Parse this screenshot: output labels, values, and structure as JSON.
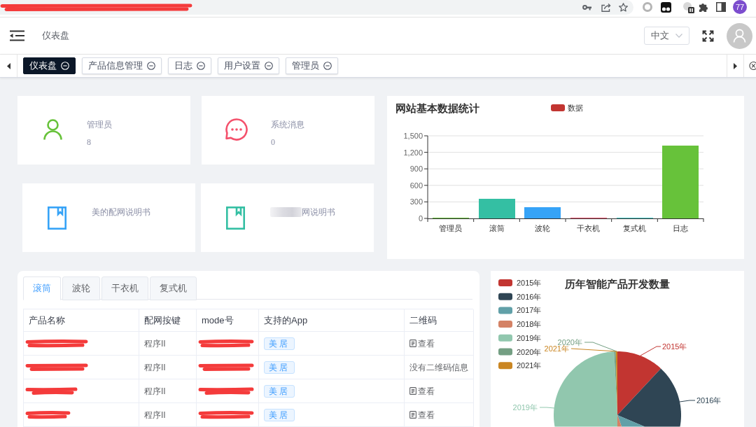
{
  "browser": {
    "address_redacted": true,
    "profile": "77"
  },
  "header": {
    "breadcrumb": "仪表盘",
    "language": "中文"
  },
  "tabs": [
    {
      "label": "仪表盘",
      "selected": true
    },
    {
      "label": "产品信息管理",
      "selected": false
    },
    {
      "label": "日志",
      "selected": false
    },
    {
      "label": "用户设置",
      "selected": false
    },
    {
      "label": "管理员",
      "selected": false
    }
  ],
  "stat_cards": [
    {
      "label": "管理员",
      "value": "8"
    },
    {
      "label": "系统消息",
      "value": "0"
    }
  ],
  "manual_cards": [
    {
      "title": "美的配网说明书",
      "blurred": false
    },
    {
      "title": "网说明书",
      "blurred": true
    }
  ],
  "bar_chart": {
    "chart_data": {
      "type": "bar",
      "title": "网站基本数据统计",
      "categories": [
        "管理员",
        "滚筒",
        "波轮",
        "干衣机",
        "复式机",
        "日志"
      ],
      "series": [
        {
          "name": "数据",
          "values": [
            8,
            350,
            200,
            10,
            5,
            1320
          ]
        }
      ],
      "ylim": [
        0,
        1500
      ],
      "yticks": [
        0,
        300,
        600,
        900,
        {
          "value": 1200,
          "label": "1,200"
        },
        {
          "value": 1500,
          "label": "1,500"
        }
      ],
      "grid": true
    },
    "legend_swatch": {
      "color": "#c23531"
    },
    "bars": [
      {
        "color": "#67c23a"
      },
      {
        "color": "#34bfa3"
      },
      {
        "color": "#36a3f7"
      },
      {
        "color": "#f4516c"
      },
      {
        "color": "#40c9c6"
      },
      {
        "color": "#67c23a"
      }
    ]
  },
  "product_table": {
    "tabs": [
      {
        "label": "滚筒",
        "selected": true
      },
      {
        "label": "波轮",
        "selected": false
      },
      {
        "label": "干衣机",
        "selected": false
      },
      {
        "label": "复式机",
        "selected": false
      }
    ],
    "columns": [
      "产品名称",
      "配网按键",
      "mode号",
      "支持的App",
      "二维码"
    ],
    "rows": [
      {
        "cells": [
          {
            "kind": "redacted"
          },
          {
            "kind": "text",
            "text": "程序II"
          },
          {
            "kind": "redacted"
          },
          {
            "kind": "tag",
            "text": "美居"
          },
          {
            "kind": "link",
            "text": "查看"
          }
        ]
      },
      {
        "cells": [
          {
            "kind": "redacted"
          },
          {
            "kind": "text",
            "text": "程序II"
          },
          {
            "kind": "redacted"
          },
          {
            "kind": "tag",
            "text": "美居"
          },
          {
            "kind": "text",
            "text": "没有二维码信息"
          }
        ]
      },
      {
        "cells": [
          {
            "kind": "redacted"
          },
          {
            "kind": "text",
            "text": "程序II"
          },
          {
            "kind": "redacted"
          },
          {
            "kind": "tag",
            "text": "美居"
          },
          {
            "kind": "link",
            "text": "查看"
          }
        ]
      },
      {
        "cells": [
          {
            "kind": "redacted"
          },
          {
            "kind": "text",
            "text": "程序II"
          },
          {
            "kind": "redacted"
          },
          {
            "kind": "tag",
            "text": "美居"
          },
          {
            "kind": "link",
            "text": "查看"
          }
        ]
      }
    ]
  },
  "pie_chart": {
    "title": "历年智能产品开发数量",
    "slices": [
      {
        "legend": "2015年",
        "color": "#c23531",
        "label": "2015年"
      },
      {
        "legend": "2016年",
        "color": "#2f4554",
        "label": "2016年"
      },
      {
        "legend": "2017年",
        "color": "#61a0a8"
      },
      {
        "legend": "2018年",
        "color": "#d48265"
      },
      {
        "legend": "2019年",
        "color": "#91c7ae",
        "label": "2019年"
      },
      {
        "legend": "2020年",
        "color": "#749f83",
        "label": "2020年"
      },
      {
        "legend": "2021年",
        "color": "#ca8622",
        "label": "2021年"
      }
    ]
  }
}
